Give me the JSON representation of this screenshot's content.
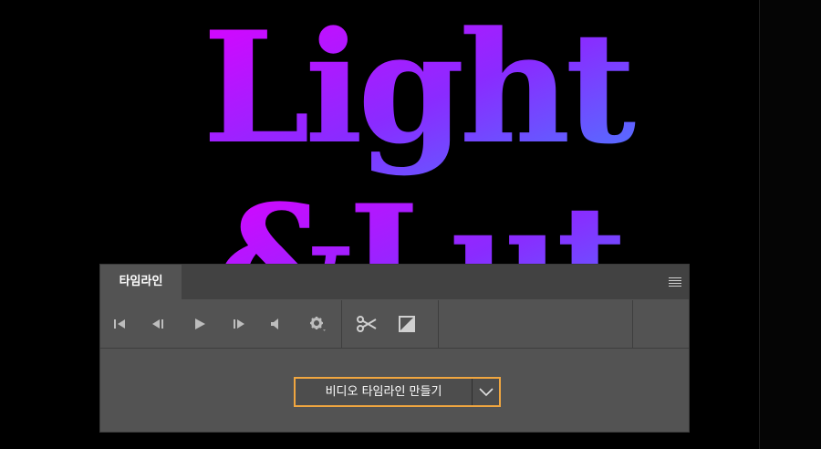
{
  "artwork": {
    "line1": "Light",
    "line2": "&Lut",
    "gradient_start": "#e100ff",
    "gradient_end": "#4a7bff"
  },
  "panel": {
    "tab_label": "타임라인",
    "menu_icon": "panel-menu-icon"
  },
  "toolbar": {
    "icons": [
      "go-to-first-frame-icon",
      "previous-frame-icon",
      "play-icon",
      "next-frame-icon",
      "audio-icon",
      "settings-icon",
      "split-scissors-icon",
      "transition-icon"
    ]
  },
  "create": {
    "label": "비디오 타임라인 만들기",
    "dropdown_icon": "chevron-down-icon",
    "highlight_color": "#f0a640"
  }
}
